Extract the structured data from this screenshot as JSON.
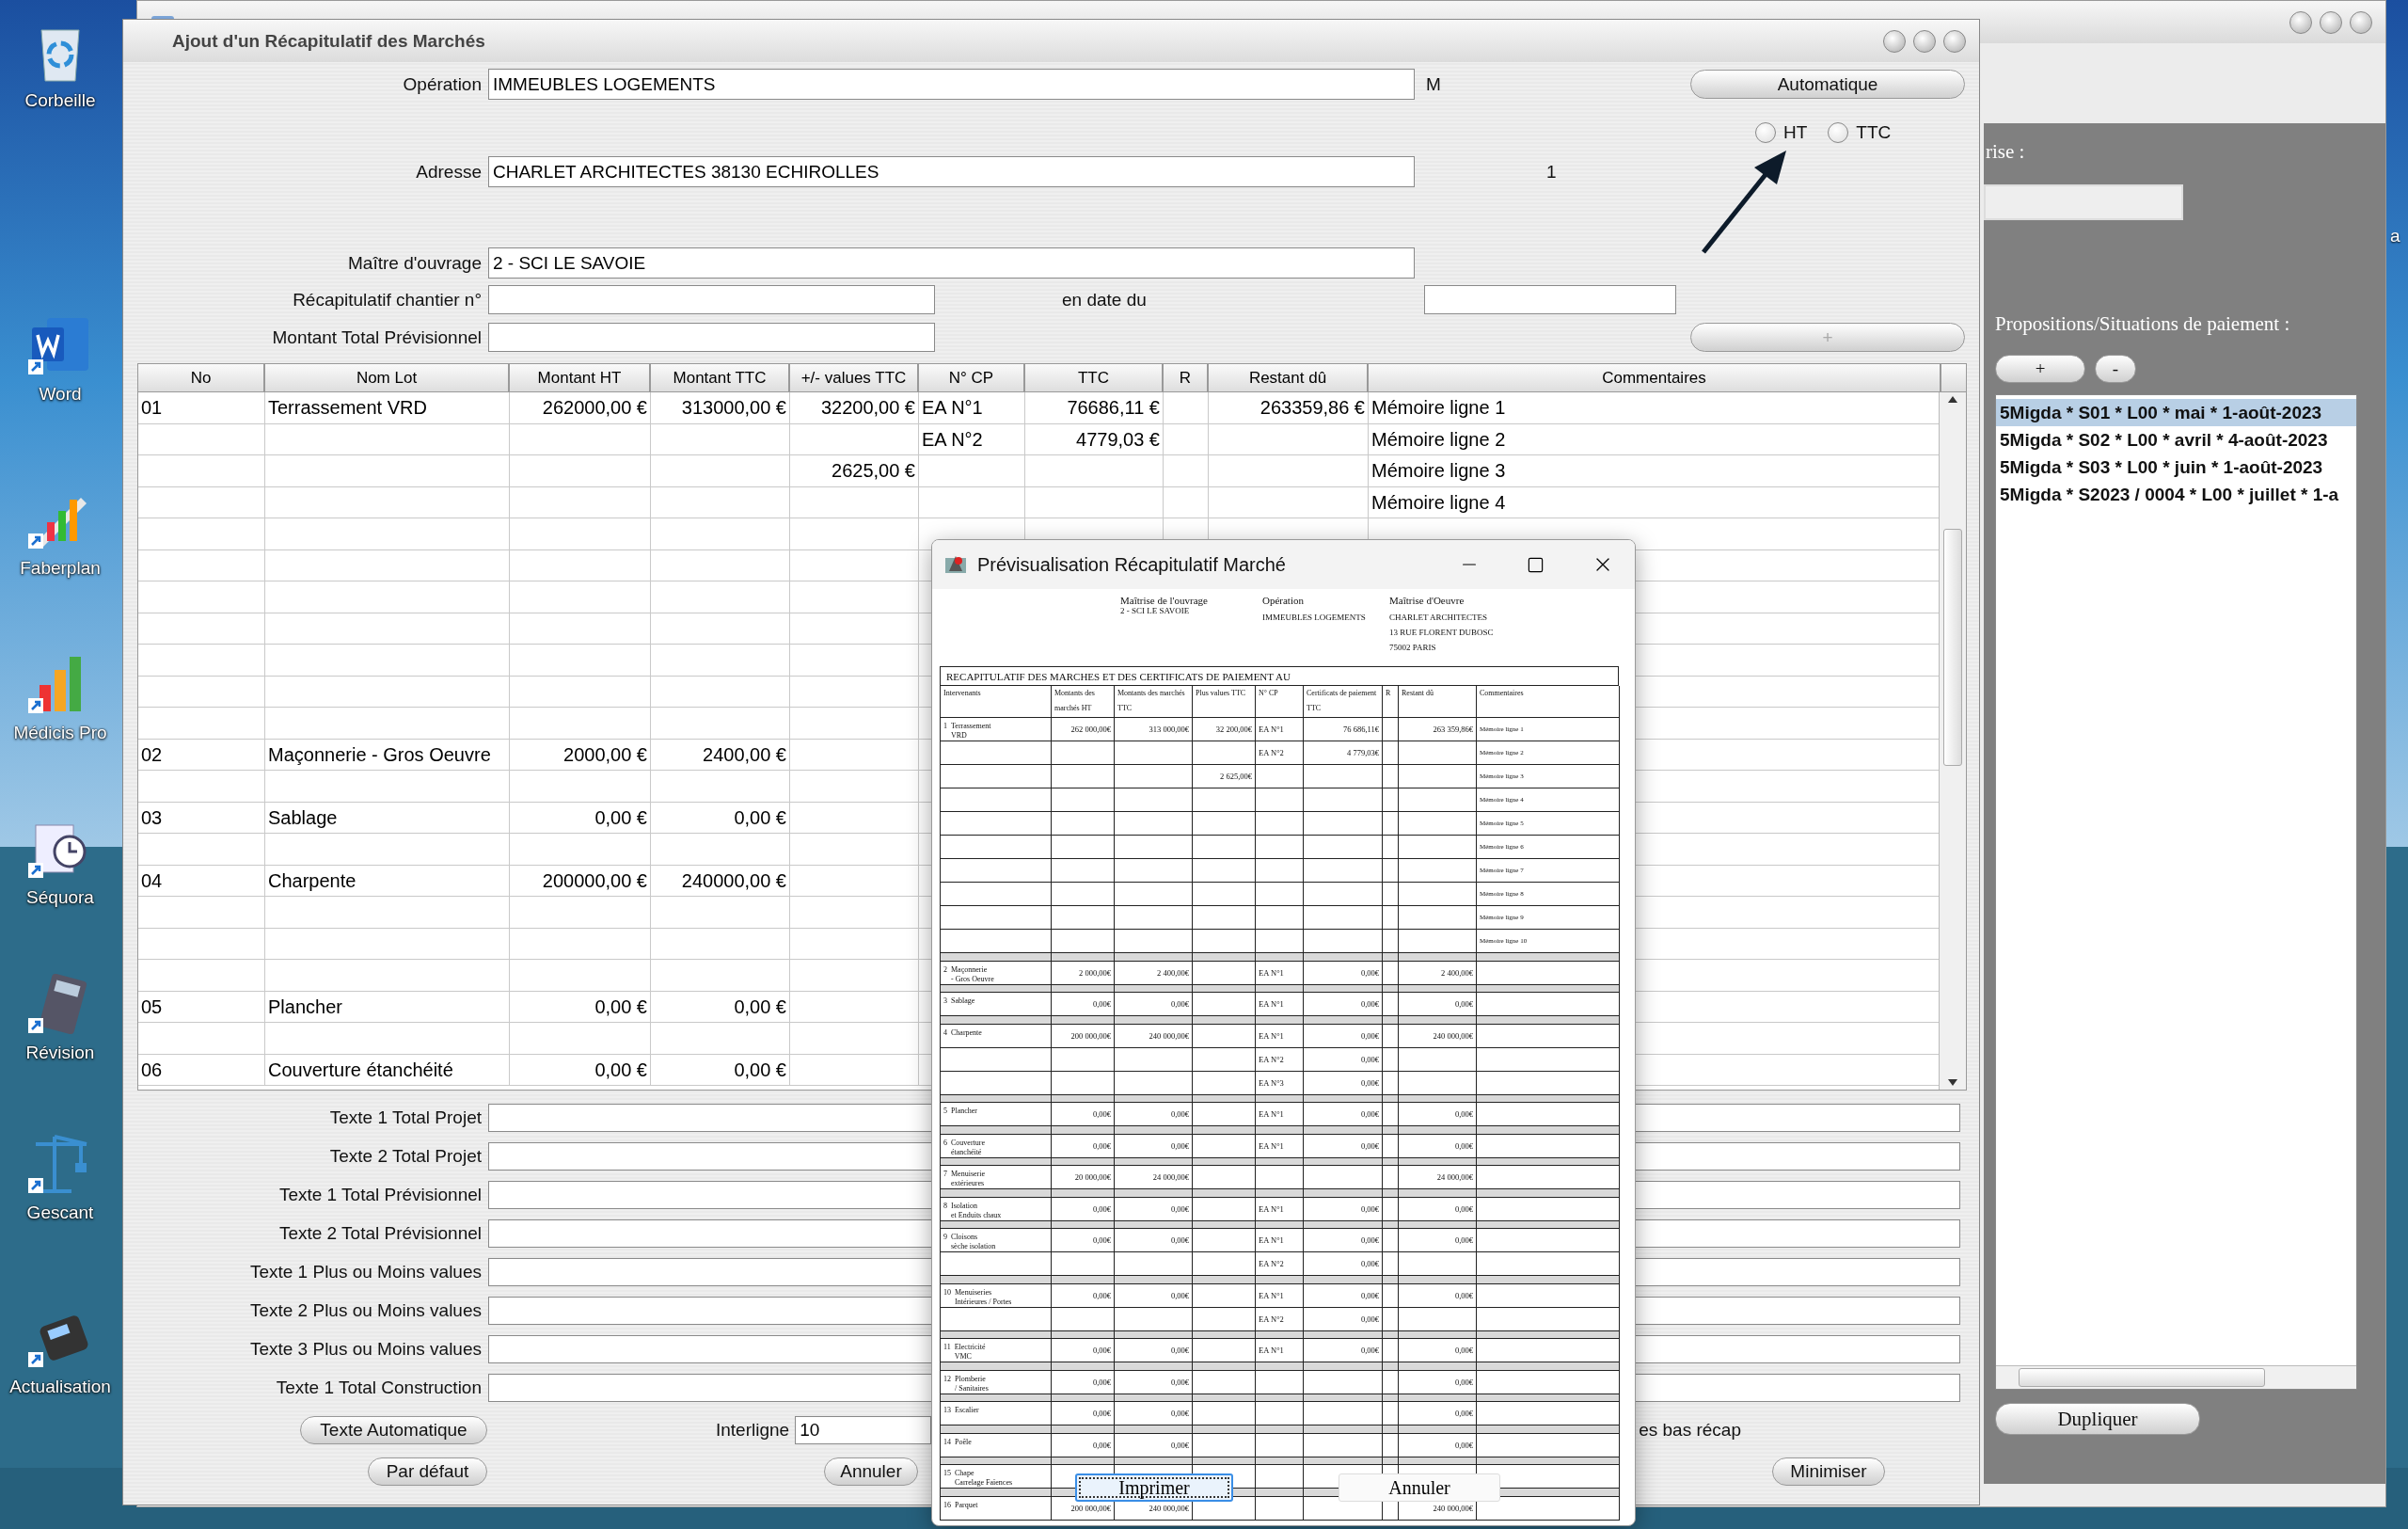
{
  "desktop": {
    "icons": [
      {
        "label": "Corbeille"
      },
      {
        "label": "Word"
      },
      {
        "label": "Faberplan"
      },
      {
        "label": "Médicis Pro"
      },
      {
        "label": "Séquora"
      },
      {
        "label": "Révision"
      },
      {
        "label": "Gescant"
      },
      {
        "label": "Actualisation"
      }
    ],
    "edge_label": "a"
  },
  "back_window": {
    "panel": {
      "label": "rise :",
      "list_title": "Propositions/Situations de paiement :",
      "add_button": "+",
      "remove_button": "-",
      "items": [
        {
          "text": "5Migda * S01 * L00 * mai * 1-août-2023",
          "selected": true
        },
        {
          "text": "5Migda * S02 * L00 * avril * 4-août-2023",
          "selected": false
        },
        {
          "text": "5Migda * S03 * L00 * juin * 1-août-2023",
          "selected": false
        },
        {
          "text": "5Migda * S2023 / 0004 * L00 * juillet * 1-a",
          "selected": false
        }
      ],
      "duplicate_button": "Dupliquer"
    }
  },
  "dialog": {
    "title": "Ajout d'un Récapitulatif des Marchés",
    "operation": {
      "label": "Opération",
      "value": "IMMEUBLES LOGEMENTS"
    },
    "unit": "M",
    "auto_button": "Automatique",
    "radios": [
      {
        "label": "HT",
        "selected": false
      },
      {
        "label": "TTC",
        "selected": false
      }
    ],
    "address": {
      "label": "Adresse",
      "value": "CHARLET ARCHITECTES 38130 ECHIROLLES"
    },
    "counter": "1",
    "owner": {
      "label": "Maître d'ouvrage",
      "value": "2 - SCI LE SAVOIE"
    },
    "recap_number": {
      "label": "Récapitulatif chantier n°"
    },
    "date": {
      "label": "en date du"
    },
    "forecast_total": {
      "label": "Montant Total Prévisionnel"
    },
    "plus_button": {
      "label": "+",
      "disabled": true
    },
    "table": {
      "columns": [
        {
          "label": "No"
        },
        {
          "label": "Nom Lot"
        },
        {
          "label": "Montant HT"
        },
        {
          "label": "Montant TTC"
        },
        {
          "label": "+/- values TTC"
        },
        {
          "label": "N° CP"
        },
        {
          "label": "TTC"
        },
        {
          "label": "R"
        },
        {
          "label": "Restant dû"
        },
        {
          "label": "Commentaires"
        }
      ],
      "rows": [
        {
          "no": "01",
          "lot": "Terrassement VRD",
          "ht": "262000,00 €",
          "ttc": "313000,00 €",
          "pm": "32200,00 €",
          "cp": "EA N°1",
          "cp_ttc": "76686,11 €",
          "rest": "263359,86 €",
          "comment": "Mémoire ligne 1"
        },
        {
          "cp": "EA N°2",
          "cp_ttc": "4779,03 €",
          "comment": "Mémoire ligne 2"
        },
        {
          "pm": "2625,00 €",
          "comment": "Mémoire ligne 3"
        },
        {
          "comment": "Mémoire ligne 4"
        },
        {},
        {},
        {},
        {},
        {},
        {},
        {},
        {
          "no": "02",
          "lot": "Maçonnerie - Gros Oeuvre",
          "ht": "2000,00 €",
          "ttc": "2400,00 €"
        },
        {},
        {
          "no": "03",
          "lot": "Sablage",
          "ht": "0,00 €",
          "ttc": "0,00 €"
        },
        {},
        {
          "no": "04",
          "lot": "Charpente",
          "ht": "200000,00 €",
          "ttc": "240000,00 €"
        },
        {},
        {},
        {},
        {
          "no": "05",
          "lot": "Plancher",
          "ht": "0,00 €",
          "ttc": "0,00 €"
        },
        {},
        {
          "no": "06",
          "lot": "Couverture étanchéité",
          "ht": "0,00 €",
          "ttc": "0,00 €"
        }
      ]
    },
    "text_fields": [
      {
        "label": "Texte 1 Total Projet"
      },
      {
        "label": "Texte 2 Total Projet"
      },
      {
        "label": "Texte 1 Total Prévisionnel"
      },
      {
        "label": "Texte 2 Total Prévisionnel"
      },
      {
        "label": "Texte 1 Plus ou Moins values"
      },
      {
        "label": "Texte 2 Plus ou Moins values"
      },
      {
        "label": "Texte 3 Plus ou Moins values"
      },
      {
        "label": "Texte 1 Total Construction"
      }
    ],
    "auto_text_button": "Texte Automatique",
    "line_spacing": {
      "label": "Interligne",
      "value": "10"
    },
    "bottom_option": "es bas récap",
    "default_button": "Par défaut",
    "cancel_button": "Annuler",
    "minimize_button": "Minimiser"
  },
  "preview": {
    "title": "Prévisualisation Récapitulatif Marché",
    "header": [
      {
        "title": "Maîtrise de l'ouvrage",
        "lines": [
          "2 - SCI LE SAVOIE"
        ]
      },
      {
        "title": "Opération",
        "lines": [
          "IMMEUBLES LOGEMENTS"
        ]
      },
      {
        "title": "Maîtrise d'Oeuvre",
        "lines": [
          "CHARLET ARCHITECTES",
          "13 RUE FLORENT DUBOSC",
          "75002 PARIS"
        ]
      }
    ],
    "report_title": "RECAPITULATIF DES MARCHES ET DES CERTIFICATS DE PAIEMENT AU",
    "columns": [
      "Intervenants",
      "Montants des marchés HT",
      "Montants des marchés TTC",
      "Plus values TTC",
      "N° CP",
      "Certificats de paiement TTC",
      "R",
      "Restant dû",
      "Commentaires"
    ],
    "lots": [
      {
        "num": "1",
        "name": "Terrassement\nVRD",
        "lines": [
          {
            "ht": "262 000,00€",
            "ttc": "313 000,00€",
            "pm": "32 200,00€",
            "cp": "EA N°1",
            "cert": "76 686,11€",
            "rest": "263 359,86€",
            "comment": "Mémoire ligne 1"
          },
          {
            "cp": "EA N°2",
            "cert": "4 779,03€",
            "comment": "Mémoire ligne 2"
          },
          {
            "pm": "2 625,00€",
            "comment": "Mémoire ligne 3"
          },
          {
            "comment": "Mémoire ligne 4"
          },
          {
            "comment": "Mémoire ligne 5"
          },
          {
            "comment": "Mémoire ligne 6"
          },
          {
            "comment": "Mémoire ligne 7"
          },
          {
            "comment": "Mémoire ligne 8"
          },
          {
            "comment": "Mémoire ligne 9"
          },
          {
            "comment": "Mémoire ligne 10"
          }
        ]
      },
      {
        "num": "2",
        "name": "Maçonnerie\n- Gros Oeuvre",
        "lines": [
          {
            "ht": "2 000,00€",
            "ttc": "2 400,00€",
            "cp": "EA N°1",
            "cert": "0,00€",
            "rest": "2 400,00€"
          }
        ]
      },
      {
        "num": "3",
        "name": "Sablage",
        "lines": [
          {
            "ht": "0,00€",
            "ttc": "0,00€",
            "cp": "EA N°1",
            "cert": "0,00€",
            "rest": "0,00€"
          }
        ]
      },
      {
        "num": "4",
        "name": "Charpente",
        "lines": [
          {
            "ht": "200 000,00€",
            "ttc": "240 000,00€",
            "cp": "EA N°1",
            "cert": "0,00€",
            "rest": "240 000,00€"
          },
          {
            "cp": "EA N°2",
            "cert": "0,00€"
          },
          {
            "cp": "EA N°3",
            "cert": "0,00€"
          }
        ]
      },
      {
        "num": "5",
        "name": "Plancher",
        "lines": [
          {
            "ht": "0,00€",
            "ttc": "0,00€",
            "cp": "EA N°1",
            "cert": "0,00€",
            "rest": "0,00€"
          }
        ]
      },
      {
        "num": "6",
        "name": "Couverture\nétanchéité",
        "lines": [
          {
            "ht": "0,00€",
            "ttc": "0,00€",
            "cp": "EA N°1",
            "cert": "0,00€",
            "rest": "0,00€"
          }
        ]
      },
      {
        "num": "7",
        "name": "Menuiserie\nextérieures",
        "lines": [
          {
            "ht": "20 000,00€",
            "ttc": "24 000,00€",
            "rest": "24 000,00€"
          }
        ]
      },
      {
        "num": "8",
        "name": "Isolation\net Enduits chaux",
        "lines": [
          {
            "ht": "0,00€",
            "ttc": "0,00€",
            "cp": "EA N°1",
            "cert": "0,00€",
            "rest": "0,00€"
          }
        ]
      },
      {
        "num": "9",
        "name": "Cloisons\nsèche isolation",
        "lines": [
          {
            "ht": "0,00€",
            "ttc": "0,00€",
            "cp": "EA N°1",
            "cert": "0,00€",
            "rest": "0,00€"
          },
          {
            "cp": "EA N°2",
            "cert": "0,00€"
          }
        ]
      },
      {
        "num": "10",
        "name": "Menuiseries\nIntérieures / Portes",
        "lines": [
          {
            "ht": "0,00€",
            "ttc": "0,00€",
            "cp": "EA N°1",
            "cert": "0,00€",
            "rest": "0,00€"
          },
          {
            "cp": "EA N°2",
            "cert": "0,00€"
          }
        ]
      },
      {
        "num": "11",
        "name": "Electricité\nVMC",
        "lines": [
          {
            "ht": "0,00€",
            "ttc": "0,00€",
            "cp": "EA N°1",
            "cert": "0,00€",
            "rest": "0,00€"
          }
        ]
      },
      {
        "num": "12",
        "name": "Plomberie\n/ Sanitaires",
        "lines": [
          {
            "ht": "0,00€",
            "ttc": "0,00€",
            "rest": "0,00€"
          }
        ]
      },
      {
        "num": "13",
        "name": "Escalier",
        "lines": [
          {
            "ht": "0,00€",
            "ttc": "0,00€",
            "rest": "0,00€"
          }
        ]
      },
      {
        "num": "14",
        "name": "Poêle",
        "lines": [
          {
            "ht": "0,00€",
            "ttc": "0,00€",
            "rest": "0,00€"
          }
        ]
      },
      {
        "num": "15",
        "name": "Chape\nCarrelage Faïences"
      },
      {
        "num": "16",
        "name": "Parquet",
        "lines": [
          {
            "ht": "200 000,00€",
            "ttc": "240 000,00€",
            "rest": "240 000,00€"
          }
        ]
      }
    ],
    "print_button": "Imprimer",
    "cancel_button": "Annuler"
  }
}
